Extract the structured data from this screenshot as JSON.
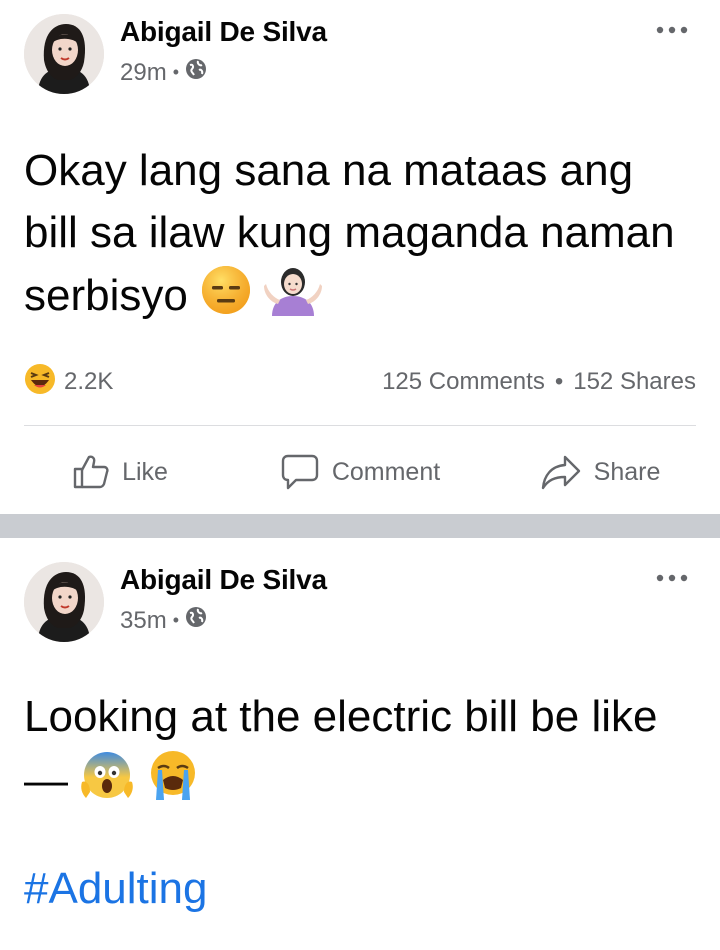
{
  "posts": [
    {
      "author": "Abigail De Silva",
      "time": "29m",
      "text": "Okay lang sana na mataas ang bill sa ilaw kung maganda naman serbisyo",
      "emojis": [
        "expressionless-face",
        "woman-shrugging"
      ],
      "reactions": {
        "icon": "laughing-face",
        "count": "2.2K"
      },
      "comments": "125 Comments",
      "shares": "152 Shares",
      "actions": {
        "like": "Like",
        "comment": "Comment",
        "share": "Share"
      }
    },
    {
      "author": "Abigail De Silva",
      "time": "35m",
      "text": "Looking at the electric bill be like —",
      "emojis": [
        "face-screaming-in-fear",
        "loudly-crying-face"
      ],
      "hashtag": "#Adulting"
    }
  ],
  "icons": {
    "privacy": "globe-icon",
    "menu": "more-options-icon"
  },
  "colors": {
    "hashtag": "#1b74e4",
    "secondary_text": "#65676b",
    "separator": "#c9ccd1"
  }
}
